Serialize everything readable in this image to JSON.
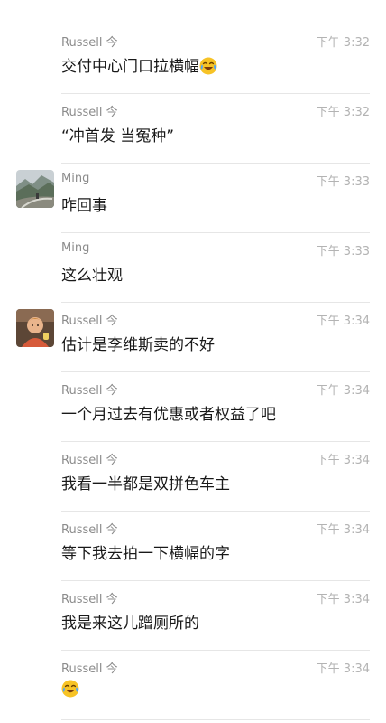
{
  "messages": [
    {
      "sender": "Russell 今",
      "time": "下午 3:32",
      "text": "交付中心门口拉横幅",
      "emoji": "laughing-crying-emoji"
    },
    {
      "sender": "Russell 今",
      "time": "下午 3:32",
      "text": "“冲首发 当冤种”"
    },
    {
      "sender": "Ming",
      "time": "下午 3:33",
      "text": "咋回事",
      "avatar": "mountain-road-photo"
    },
    {
      "sender": "Ming",
      "time": "下午 3:33",
      "text": "这么壮观"
    },
    {
      "sender": "Russell 今",
      "time": "下午 3:34",
      "text": "估计是李维斯卖的不好",
      "avatar": "child-portrait-photo"
    },
    {
      "sender": "Russell 今",
      "time": "下午 3:34",
      "text": "一个月过去有优惠或者权益了吧"
    },
    {
      "sender": "Russell 今",
      "time": "下午 3:34",
      "text": "我看一半都是双拼色车主"
    },
    {
      "sender": "Russell 今",
      "time": "下午 3:34",
      "text": "等下我去拍一下横幅的字"
    },
    {
      "sender": "Russell 今",
      "time": "下午 3:34",
      "text": "我是来这儿蹭厕所的"
    },
    {
      "sender": "Russell 今",
      "time": "下午 3:34",
      "text": "",
      "emoji": "laughing-crying-emoji"
    }
  ]
}
